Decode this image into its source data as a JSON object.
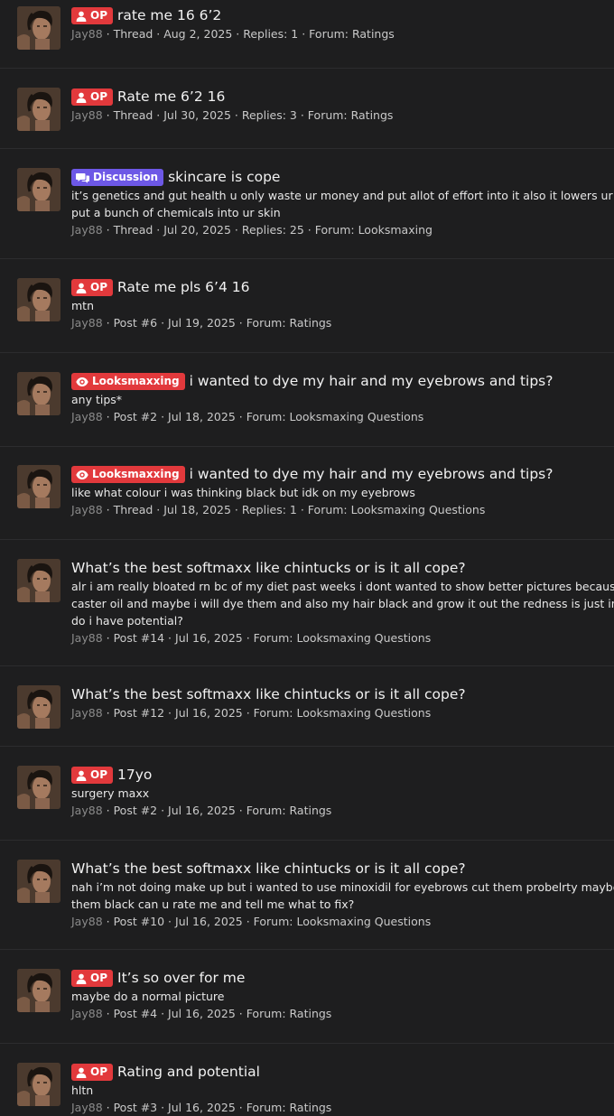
{
  "items": [
    {
      "badge": "OP",
      "badge_type": "op",
      "title": "rate me 16 6’2",
      "snippet": [],
      "user": "Jay88",
      "meta": " · Thread · Aug 2, 2025 · Replies: 1 · Forum: Ratings"
    },
    {
      "badge": "OP",
      "badge_type": "op",
      "title": "Rate me 6’2 16",
      "snippet": [],
      "user": "Jay88",
      "meta": " · Thread · Jul 30, 2025 · Replies: 3 · Forum: Ratings"
    },
    {
      "badge": "Discussion",
      "badge_type": "disc",
      "title": "skincare is cope",
      "snippet": [
        "it’s genetics and gut health u only waste ur money and put allot of effort into it also it lowers ur testosterone when u",
        "put a bunch of chemicals into ur skin"
      ],
      "user": "Jay88",
      "meta": " · Thread · Jul 20, 2025 · Replies: 25 · Forum: Looksmaxing"
    },
    {
      "badge": "OP",
      "badge_type": "op",
      "title": "Rate me pls 6’4 16",
      "snippet": [
        "mtn"
      ],
      "user": "Jay88",
      "meta": " · Post #6 · Jul 19, 2025 · Forum: Ratings"
    },
    {
      "badge": "Looksmaxxing",
      "badge_type": "looks",
      "title": "i wanted to dye my hair and my eyebrows and tips?",
      "snippet": [
        "any tips*"
      ],
      "user": "Jay88",
      "meta": " · Post #2 · Jul 18, 2025 · Forum: Looksmaxing Questions"
    },
    {
      "badge": "Looksmaxxing",
      "badge_type": "looks",
      "title": "i wanted to dye my hair and my eyebrows and tips?",
      "snippet": [
        "like what colour i was thinking black but idk on my eyebrows"
      ],
      "user": "Jay88",
      "meta": " · Thread · Jul 18, 2025 · Replies: 1 · Forum: Looksmaxing Questions"
    },
    {
      "badge": "",
      "badge_type": "",
      "title": "What’s the best softmaxx like chintucks or is it all cope?",
      "snippet": [
        "alr i am really bloated rn bc of my diet past weeks i dont wanted to show better pictures because its cope i will use",
        "caster oil and maybe i will dye them and also my hair black and grow it out the redness is just in this picture",
        "do i have potential?"
      ],
      "user": "Jay88",
      "meta": " · Post #14 · Jul 16, 2025 · Forum: Looksmaxing Questions"
    },
    {
      "badge": "",
      "badge_type": "",
      "title": "What’s the best softmaxx like chintucks or is it all cope?",
      "snippet": [],
      "user": "Jay88",
      "meta": " · Post #12 · Jul 16, 2025 · Forum: Looksmaxing Questions"
    },
    {
      "badge": "OP",
      "badge_type": "op",
      "title": "17yo",
      "snippet": [
        "surgery maxx"
      ],
      "user": "Jay88",
      "meta": " · Post #2 · Jul 16, 2025 · Forum: Ratings"
    },
    {
      "badge": "",
      "badge_type": "",
      "title": "What’s the best softmaxx like chintucks or is it all cope?",
      "snippet": [
        "nah i’m not doing make up but i wanted to use minoxidil for eyebrows cut them probelrty maybe cut them and dye",
        "them black can u rate me and tell me what to fix?"
      ],
      "user": "Jay88",
      "meta": " · Post #10 · Jul 16, 2025 · Forum: Looksmaxing Questions"
    },
    {
      "badge": "OP",
      "badge_type": "op",
      "title": "It’s so over for me",
      "snippet": [
        "maybe do a normal picture"
      ],
      "user": "Jay88",
      "meta": " · Post #4 · Jul 16, 2025 · Forum: Ratings"
    },
    {
      "badge": "OP",
      "badge_type": "op",
      "title": "Rating and potential",
      "snippet": [
        "hltn"
      ],
      "user": "Jay88",
      "meta": " · Post #3 · Jul 16, 2025 · Forum: Ratings"
    }
  ]
}
